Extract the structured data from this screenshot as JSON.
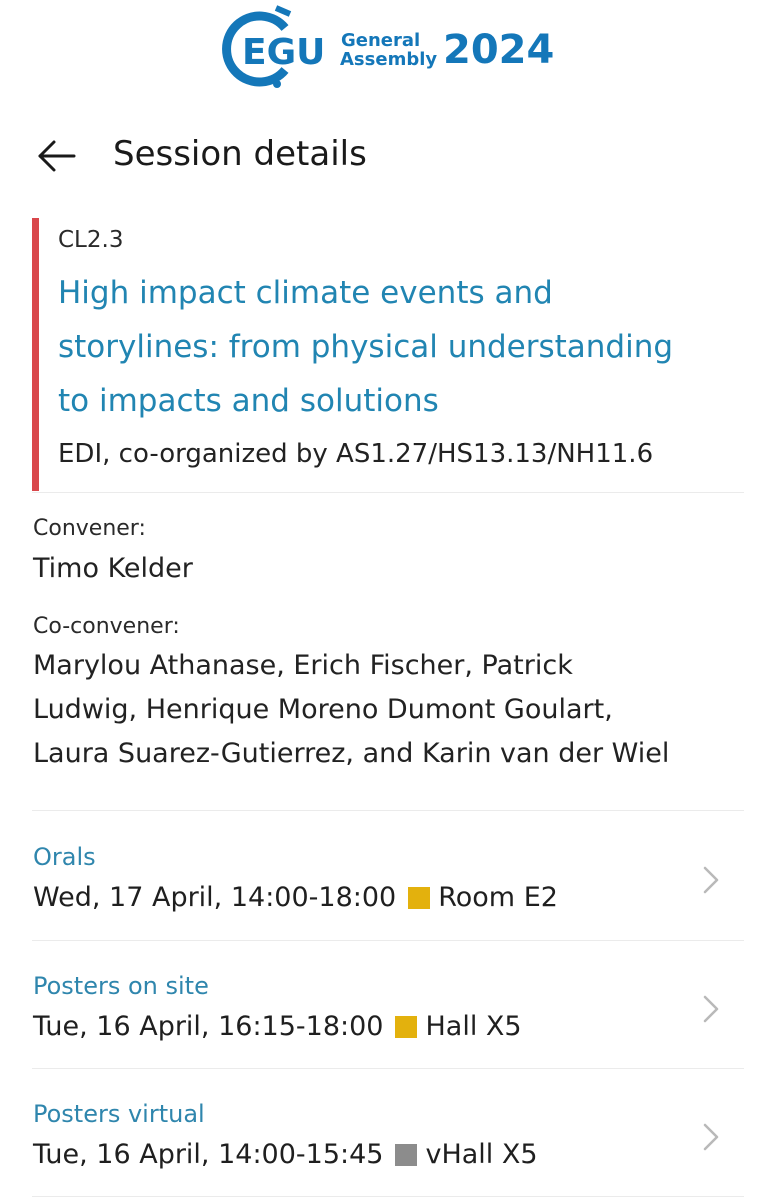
{
  "brand": {
    "logo_letters": "EGU",
    "logo_line1": "General",
    "logo_line2": "Assembly",
    "logo_year": "2024",
    "color": "#1477b9"
  },
  "header": {
    "title": "Session details"
  },
  "session": {
    "code": "CL2.3",
    "title": "High impact climate events and\nstorylines: from physical understanding\nto impacts and solutions",
    "organizer": "EDI, co-organized by AS1.27/HS13.13/NH11.6",
    "accent_color": "#d9474b",
    "title_color": "#2185b2"
  },
  "people": {
    "convener_label": "Convener:",
    "convener_names": "Timo Kelder",
    "coconvener_label": "Co-convener:",
    "coconvener_names": "Marylou Athanase, Erich Fischer, Patrick\nLudwig, Henrique Moreno Dumont Goulart,\nLaura Suarez-Gutierrez, and Karin van der Wiel"
  },
  "schedule": [
    {
      "type": "Orals",
      "when": "Wed, 17 April, 14:00-18:00",
      "room": "Room E2",
      "room_color": "#e3b10d",
      "icon": "chevron-right-icon"
    },
    {
      "type": "Posters on site",
      "when": "Tue, 16 April, 16:15-18:00",
      "room": "Hall X5",
      "room_color": "#e3b10d",
      "icon": "chevron-right-icon"
    },
    {
      "type": "Posters virtual",
      "when": "Tue, 16 April, 14:00-15:45",
      "room": "vHall X5",
      "room_color": "#8c8c8c",
      "icon": "chevron-right-icon"
    }
  ]
}
